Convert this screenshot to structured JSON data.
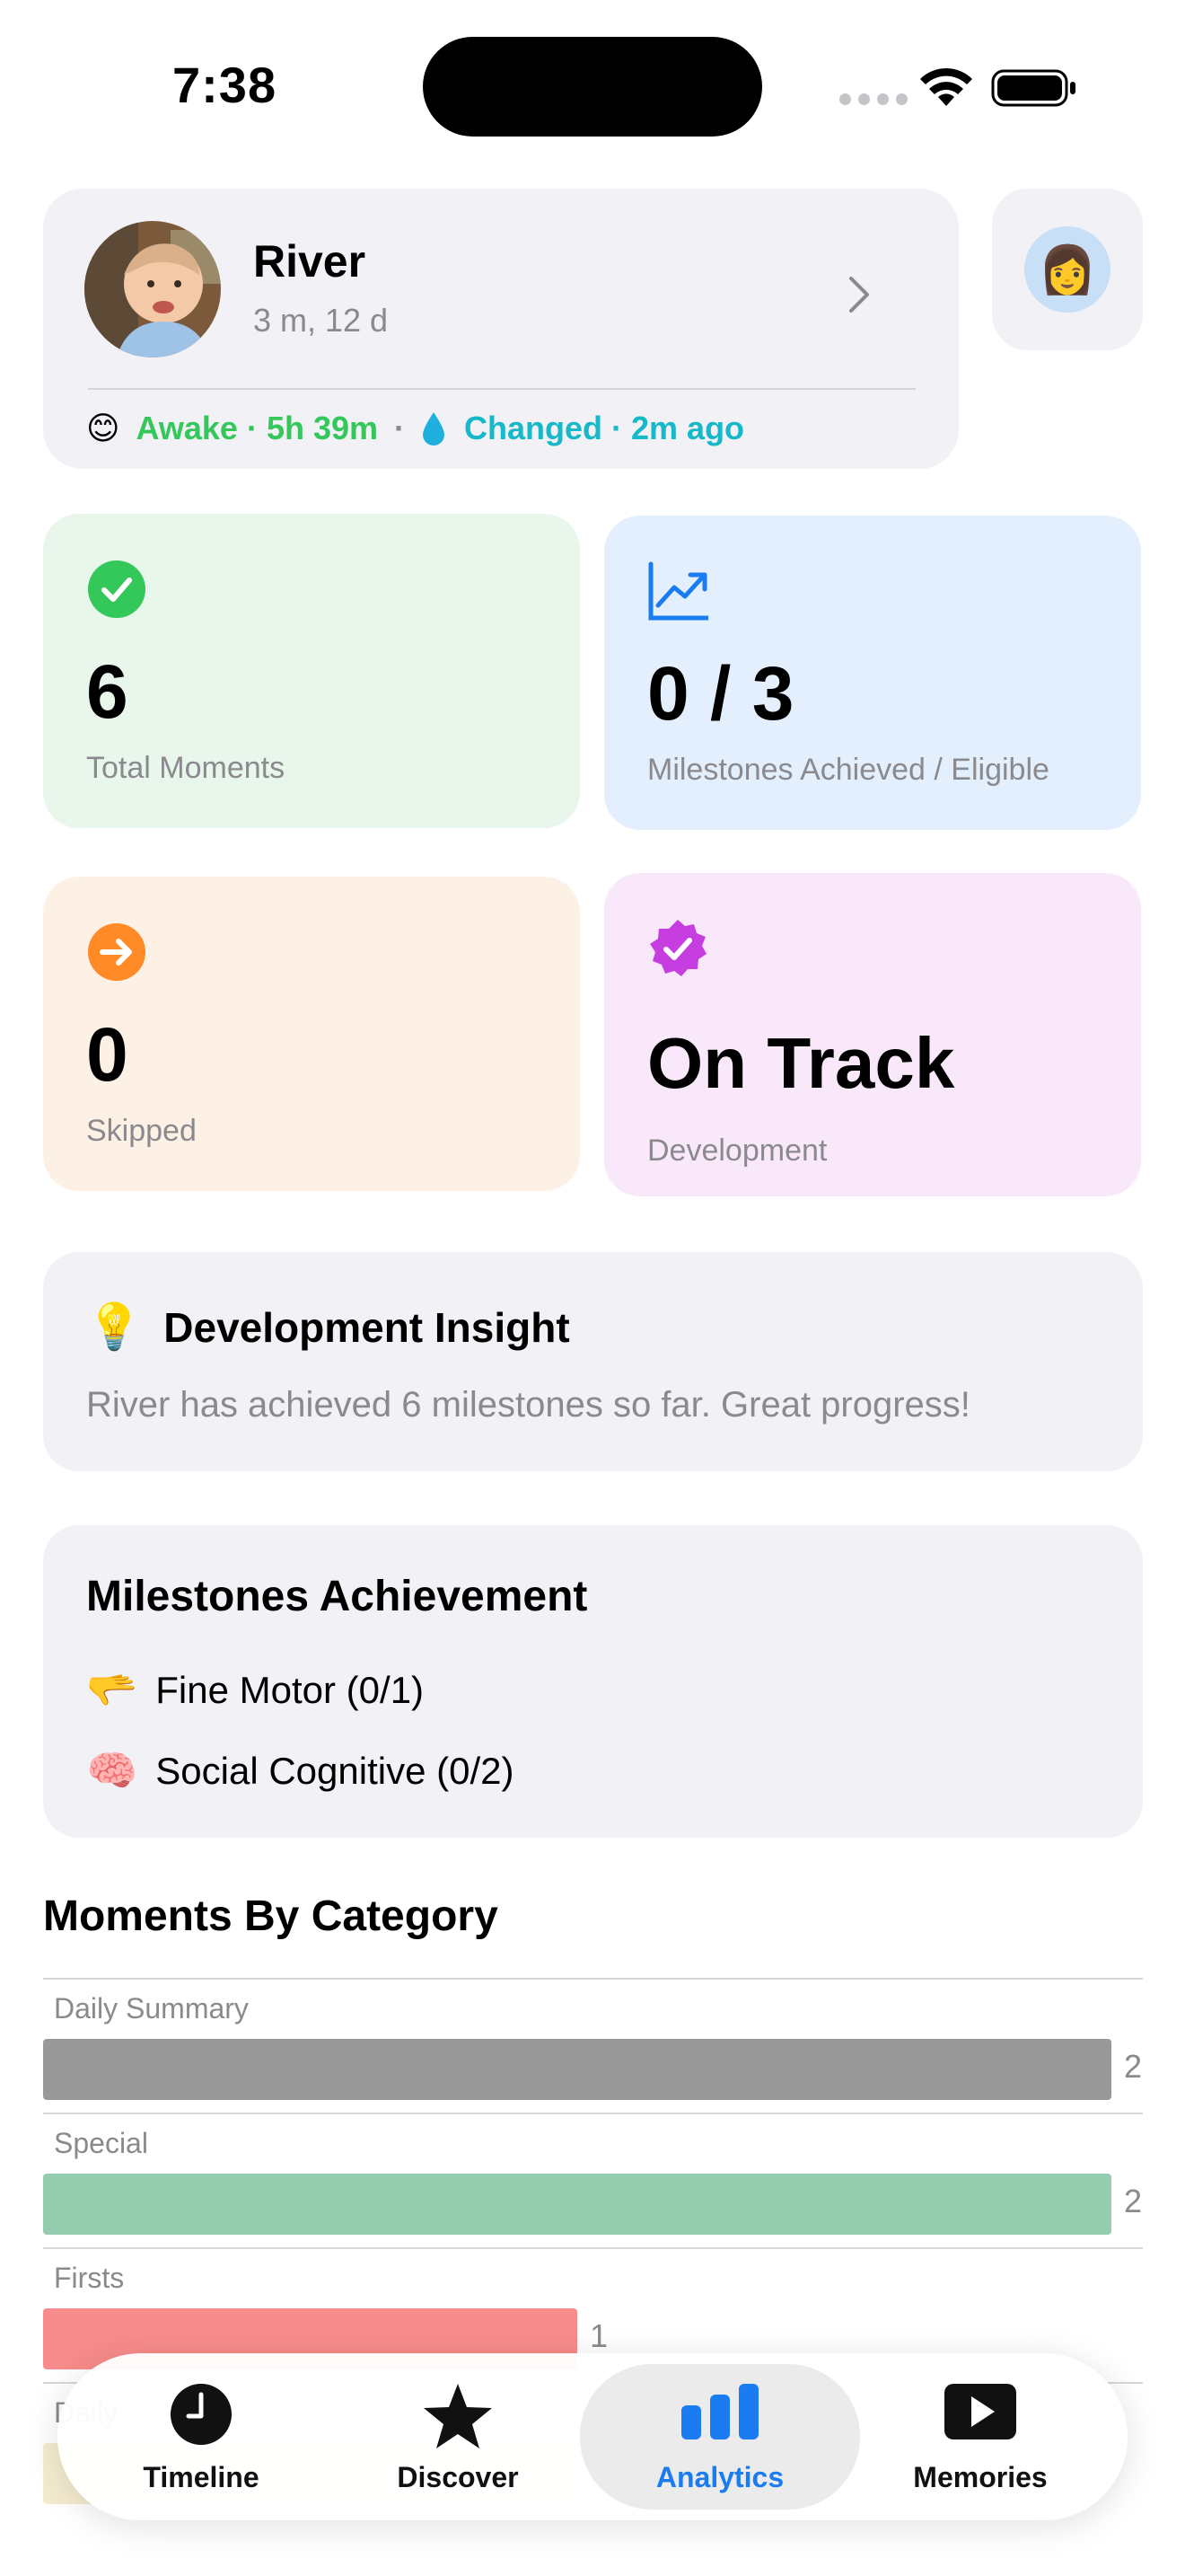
{
  "status_bar": {
    "time": "7:38"
  },
  "profile": {
    "name": "River",
    "age": "3 m, 12 d",
    "awake_emoji": "😊",
    "awake_status": "Awake · 5h 39m",
    "separator": "·",
    "changed_status": "Changed · 2m ago",
    "parent_emoji": "👩"
  },
  "stats": {
    "moments": {
      "value": "6",
      "label": "Total Moments",
      "icon": "check-circle-icon",
      "color": "#34c759"
    },
    "milestones": {
      "value": "0 / 3",
      "label": "Milestones Achieved / Eligible",
      "icon": "trend-chart-icon",
      "color": "#1a7cf0"
    },
    "skipped": {
      "value": "0",
      "label": "Skipped",
      "icon": "arrow-circle-icon",
      "color": "#ff8a26"
    },
    "track": {
      "value": "On Track",
      "label": "Development",
      "icon": "verified-badge-icon",
      "color": "#c63ee0"
    }
  },
  "insight": {
    "emoji": "💡",
    "title": "Development Insight",
    "text": "River has achieved 6 milestones so far. Great progress!"
  },
  "milestones": {
    "title": "Milestones Achievement",
    "items": [
      {
        "emoji": "🫳",
        "label": "Fine Motor (0/1)"
      },
      {
        "emoji": "🧠",
        "label": "Social Cognitive (0/2)"
      }
    ]
  },
  "categories": {
    "title": "Moments By Category",
    "rows": [
      {
        "label": "Daily Summary",
        "value": 2,
        "color": "#999999"
      },
      {
        "label": "Special",
        "value": 2,
        "color": "#94cdb0"
      },
      {
        "label": "Firsts",
        "value": 1,
        "color": "#f88b8b"
      },
      {
        "label": "Daily",
        "value": 1,
        "color": "#f5ecd0"
      }
    ],
    "max": 2
  },
  "tabs": [
    {
      "label": "Timeline",
      "icon": "clock-icon"
    },
    {
      "label": "Discover",
      "icon": "star-icon"
    },
    {
      "label": "Analytics",
      "icon": "bar-chart-icon",
      "active": true
    },
    {
      "label": "Memories",
      "icon": "play-icon"
    }
  ]
}
